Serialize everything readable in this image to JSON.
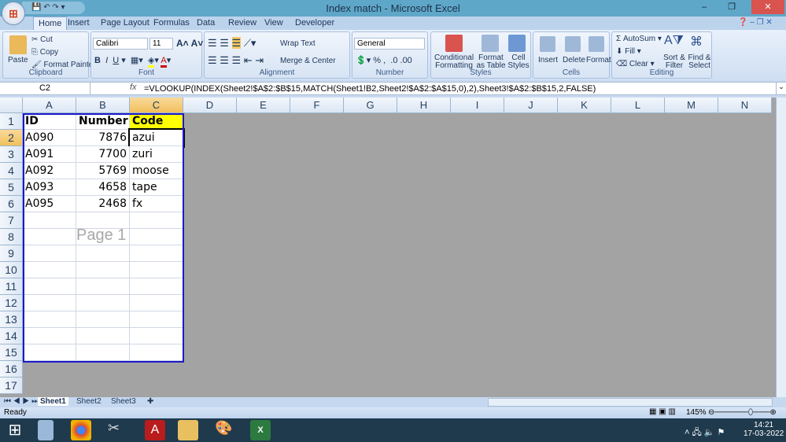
{
  "title": "Index match - Microsoft Excel",
  "tabs": [
    "Home",
    "Insert",
    "Page Layout",
    "Formulas",
    "Data",
    "Review",
    "View",
    "Developer"
  ],
  "ribbon": {
    "clipboard": {
      "label": "Clipboard",
      "paste": "Paste",
      "cut": "Cut",
      "copy": "Copy",
      "format_painter": "Format Painter"
    },
    "font": {
      "label": "Font",
      "font_name": "Calibri",
      "font_size": "11"
    },
    "alignment": {
      "label": "Alignment",
      "wrap": "Wrap Text",
      "merge": "Merge & Center"
    },
    "number": {
      "label": "Number",
      "format": "General"
    },
    "styles": {
      "label": "Styles",
      "cond": "Conditional Formatting",
      "table": "Format as Table",
      "cell": "Cell Styles"
    },
    "cells": {
      "label": "Cells",
      "insert": "Insert",
      "delete": "Delete",
      "format": "Format"
    },
    "editing": {
      "label": "Editing",
      "autosum": "AutoSum",
      "fill": "Fill",
      "clear": "Clear",
      "sort": "Sort & Filter",
      "find": "Find & Select"
    }
  },
  "formula_bar": {
    "name_box": "C2",
    "fx": "fx",
    "formula": "=VLOOKUP(INDEX(Sheet2!$A$2:$B$15,MATCH(Sheet1!B2,Sheet2!$A$2:$A$15,0),2),Sheet3!$A$2:$B$15,2,FALSE)"
  },
  "columns": [
    "A",
    "B",
    "C",
    "D",
    "E",
    "F",
    "G",
    "H",
    "I",
    "J",
    "K",
    "L",
    "M",
    "N"
  ],
  "rows": [
    "1",
    "2",
    "3",
    "4",
    "5",
    "6",
    "7",
    "8",
    "9",
    "10",
    "11",
    "12",
    "13",
    "14",
    "15",
    "16",
    "17"
  ],
  "cells": [
    [
      "ID",
      "Number",
      "Code"
    ],
    [
      "A090",
      "7876",
      "azui"
    ],
    [
      "A091",
      "7700",
      "zuri"
    ],
    [
      "A092",
      "5769",
      "moose"
    ],
    [
      "A093",
      "4658",
      "tape"
    ],
    [
      "A095",
      "2468",
      "fx"
    ]
  ],
  "page_label": "Page 1",
  "sheets": [
    "Sheet1",
    "Sheet2",
    "Sheet3"
  ],
  "status": {
    "ready": "Ready",
    "zoom": "145%"
  },
  "clock": {
    "time": "14:21",
    "date": "17-03-2022"
  },
  "colors": {
    "highlight": "#ffff00",
    "print_border": "#1a1acb"
  }
}
